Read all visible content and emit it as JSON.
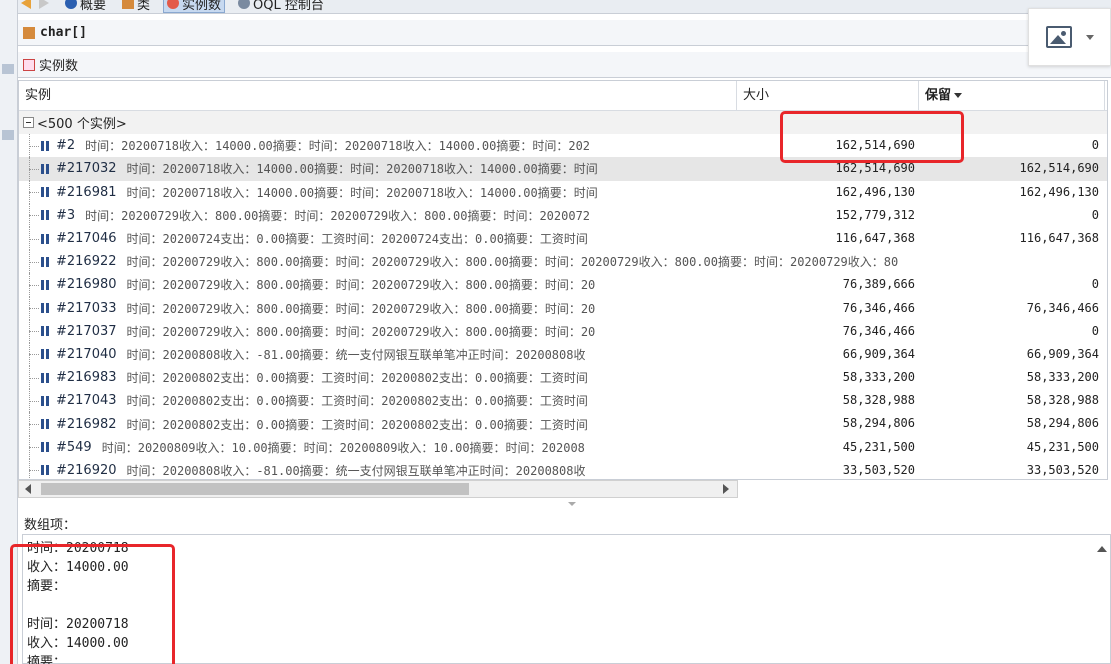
{
  "toolbar": {
    "items": [
      {
        "label": "概要",
        "icon": "info-icon"
      },
      {
        "label": "类",
        "icon": "class-icon"
      },
      {
        "label": "实例数",
        "icon": "instances-icon",
        "active": true
      },
      {
        "label": "OQL 控制台",
        "icon": "oql-icon"
      }
    ]
  },
  "title": "char[]",
  "section": "实例数",
  "table": {
    "columns": {
      "instance": "实例",
      "size": "大小",
      "retained": "保留"
    },
    "group_label": "<500 个实例>",
    "rows": [
      {
        "id": "#2",
        "text": "时间：20200718收入：14000.00摘要：时间：20200718收入：14000.00摘要：时间：202",
        "size": "162,514,690",
        "retained": "0",
        "highlight": false
      },
      {
        "id": "#217032",
        "text": "时间：20200718收入：14000.00摘要：时间：20200718收入：14000.00摘要：时间",
        "size": "162,514,690",
        "retained": "162,514,690",
        "highlight": true
      },
      {
        "id": "#216981",
        "text": "时间：20200718收入：14000.00摘要：时间：20200718收入：14000.00摘要：时间",
        "size": "162,496,130",
        "retained": "162,496,130",
        "highlight": false
      },
      {
        "id": "#3",
        "text": "时间：20200729收入：800.00摘要：时间：20200729收入：800.00摘要：时间：2020072",
        "size": "152,779,312",
        "retained": "0",
        "highlight": false
      },
      {
        "id": "#217046",
        "text": "时间：20200724支出：0.00摘要：工资时间：20200724支出：0.00摘要：工资时间",
        "size": "116,647,368",
        "retained": "116,647,368",
        "highlight": false
      },
      {
        "id": "#216922",
        "text": "时间：20200729收入：800.00摘要：时间：20200729收入：800.00摘要：时间：20200729收入：800.00摘要：时间：20200729收入：80",
        "size": "",
        "retained": "",
        "highlight": false,
        "overflow": true
      },
      {
        "id": "#216980",
        "text": "时间：20200729收入：800.00摘要：时间：20200729收入：800.00摘要：时间：20",
        "size": "76,389,666",
        "retained": "0",
        "highlight": false
      },
      {
        "id": "#217033",
        "text": "时间：20200729收入：800.00摘要：时间：20200729收入：800.00摘要：时间：20",
        "size": "76,346,466",
        "retained": "76,346,466",
        "highlight": false
      },
      {
        "id": "#217037",
        "text": "时间：20200729收入：800.00摘要：时间：20200729收入：800.00摘要：时间：20",
        "size": "76,346,466",
        "retained": "0",
        "highlight": false
      },
      {
        "id": "#217040",
        "text": "时间：20200808收入：-81.00摘要：统一支付网银互联单笔冲正时间：20200808收",
        "size": "66,909,364",
        "retained": "66,909,364",
        "highlight": false
      },
      {
        "id": "#216983",
        "text": "时间：20200802支出：0.00摘要：工资时间：20200802支出：0.00摘要：工资时间",
        "size": "58,333,200",
        "retained": "58,333,200",
        "highlight": false
      },
      {
        "id": "#217043",
        "text": "时间：20200802支出：0.00摘要：工资时间：20200802支出：0.00摘要：工资时间",
        "size": "58,328,988",
        "retained": "58,328,988",
        "highlight": false
      },
      {
        "id": "#216982",
        "text": "时间：20200802支出：0.00摘要：工资时间：20200802支出：0.00摘要：工资时间",
        "size": "58,294,806",
        "retained": "58,294,806",
        "highlight": false
      },
      {
        "id": "#549",
        "text": "时间：20200809收入：10.00摘要：时间：20200809收入：10.00摘要：时间：202008",
        "size": "45,231,500",
        "retained": "45,231,500",
        "highlight": false
      },
      {
        "id": "#216920",
        "text": "时间：20200808收入：-81.00摘要：统一支付网银互联单笔冲正时间：20200808收",
        "size": "33,503,520",
        "retained": "33,503,520",
        "highlight": false
      }
    ]
  },
  "detail": {
    "label": "数组项：",
    "lines": [
      "时间：20200718",
      "收入：14000.00",
      "摘要：",
      "",
      "时间：20200718",
      "收入：14000.00",
      "摘要："
    ]
  },
  "colors": {
    "highlight_box": "#e8262a",
    "selected_row": "#e6e6e6",
    "active_tab": "#c7d9f0"
  }
}
